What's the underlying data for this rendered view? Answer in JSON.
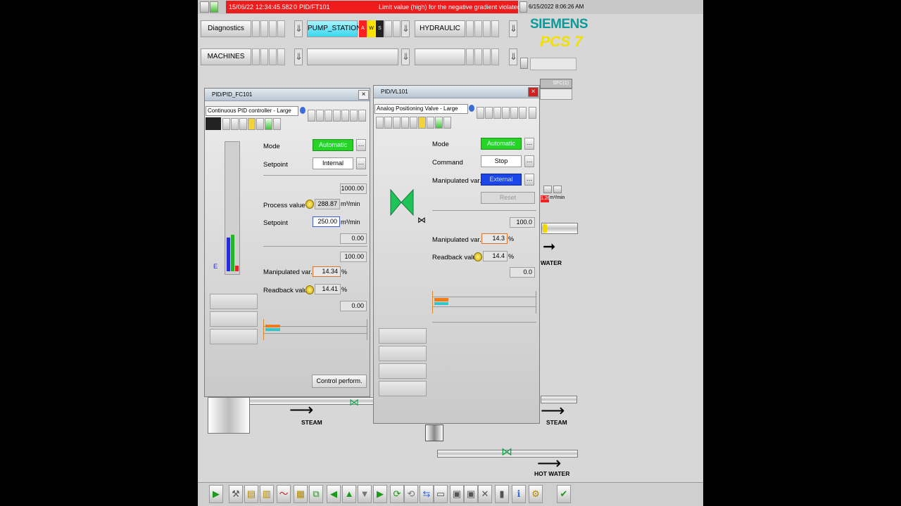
{
  "alarm": {
    "date": "15/06/22",
    "time": "12:34:45.582",
    "count": "0",
    "tag": "PID/FT101",
    "message": "Limit value (high) for the negative gradient violated",
    "datetime": "6/15/2022 8:06:26 AM",
    "color": "#ee1c1c"
  },
  "areas": {
    "diagnostics": "Diagnostics",
    "pump_station": "PUMP_STATION",
    "hydraulic": "HYDRAULIC",
    "machines": "MACHINES",
    "status_letters": [
      "A",
      "W",
      "S"
    ]
  },
  "brand": {
    "siemens": "SIEMENS",
    "pcs7": "PCS 7"
  },
  "plant": {
    "sfc": "SFC(1)",
    "water": "WATER",
    "steam_left": "STEAM",
    "steam_right": "STEAM",
    "hot_water": "HOT WATER",
    "flow_value": "1.26",
    "flow_unit": "m³/min"
  },
  "pid": {
    "title": "PID/PID_FC101",
    "view": "Continuous PID controller - Large",
    "bar_label": "E",
    "mode_label": "Mode",
    "mode_value": "Automatic",
    "setpoint_label": "Setpoint",
    "setpoint_value": "Internal",
    "scale_high": "1000.00",
    "pv_label": "Process value",
    "pv_value": "288.87",
    "pv_unit": "m³/min",
    "sp_label": "Setpoint",
    "sp_value": "250.00",
    "sp_unit": "m³/min",
    "scale_low": "0.00",
    "mv_high": "100.00",
    "mv_label": "Manipulated var.",
    "mv_value": "14.34",
    "mv_unit": "%",
    "rb_label": "Readback value",
    "rb_value": "14.41",
    "rb_unit": "%",
    "mv_low": "0.00",
    "control_perf": "Control perform.",
    "pv_fraction": 0.29
  },
  "valve": {
    "title": "PID/VL101",
    "view": "Analog Positioning Valve - Large",
    "mode_label": "Mode",
    "mode_value": "Automatic",
    "command_label": "Command",
    "command_value": "Stop",
    "mv_src_label": "Manipulated var.",
    "mv_src_value": "External",
    "reset": "Reset",
    "scale_high": "100.0",
    "mv_label": "Manipulated var.",
    "mv_value": "14.3",
    "mv_unit": "%",
    "rb_label": "Readback value",
    "rb_value": "14.4",
    "rb_unit": "%",
    "scale_low": "0.0",
    "position_fraction": 0.143
  },
  "colors": {
    "automatic_green": "#25d425",
    "external_blue": "#1c46e8",
    "brand_teal": "#0b9a9a",
    "pcs7_yellow": "#f2e000"
  }
}
